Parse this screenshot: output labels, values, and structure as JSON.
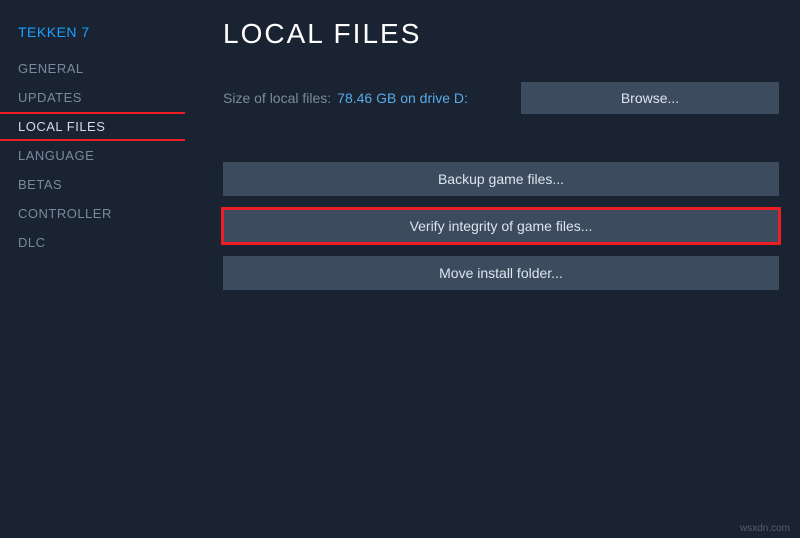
{
  "game_title": "TEKKEN 7",
  "sidebar": {
    "items": [
      {
        "label": "GENERAL",
        "name": "sidebar-item-general",
        "active": false,
        "highlighted": false
      },
      {
        "label": "UPDATES",
        "name": "sidebar-item-updates",
        "active": false,
        "highlighted": false
      },
      {
        "label": "LOCAL FILES",
        "name": "sidebar-item-local-files",
        "active": true,
        "highlighted": true
      },
      {
        "label": "LANGUAGE",
        "name": "sidebar-item-language",
        "active": false,
        "highlighted": false
      },
      {
        "label": "BETAS",
        "name": "sidebar-item-betas",
        "active": false,
        "highlighted": false
      },
      {
        "label": "CONTROLLER",
        "name": "sidebar-item-controller",
        "active": false,
        "highlighted": false
      },
      {
        "label": "DLC",
        "name": "sidebar-item-dlc",
        "active": false,
        "highlighted": false
      }
    ]
  },
  "main": {
    "title": "LOCAL FILES",
    "size_label": "Size of local files:",
    "size_value": "78.46 GB on drive D:",
    "browse_label": "Browse...",
    "actions": [
      {
        "label": "Backup game files...",
        "name": "backup-button",
        "highlighted": false
      },
      {
        "label": "Verify integrity of game files...",
        "name": "verify-button",
        "highlighted": true
      },
      {
        "label": "Move install folder...",
        "name": "move-button",
        "highlighted": false
      }
    ]
  },
  "watermark": "wsxdn.com"
}
